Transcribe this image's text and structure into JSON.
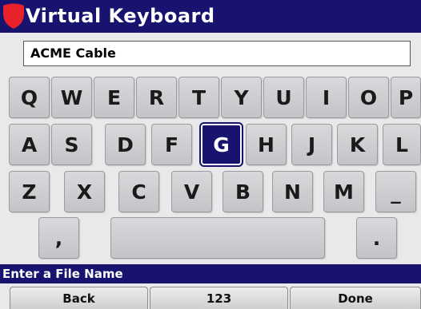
{
  "header": {
    "title": "Virtual Keyboard",
    "logo_icon": "shield-logo-icon",
    "bar_color": "#17136e",
    "logo_color": "#e8212b"
  },
  "input": {
    "value": "ACME Cable"
  },
  "keyboard": {
    "row1": [
      "Q",
      "W",
      "E",
      "R",
      "T",
      "Y",
      "U",
      "I",
      "O",
      "P"
    ],
    "row2": [
      "A",
      "S",
      "D",
      "F",
      "G",
      "H",
      "J",
      "K",
      "L"
    ],
    "row3": [
      "Z",
      "X",
      "C",
      "V",
      "B",
      "N",
      "M",
      "_"
    ],
    "row4": {
      "comma": ",",
      "space": "",
      "period": "."
    },
    "selected_key": "G"
  },
  "prompt": {
    "text": "Enter a File Name"
  },
  "softkeys": {
    "back": "Back",
    "mode": "123",
    "done": "Done"
  }
}
